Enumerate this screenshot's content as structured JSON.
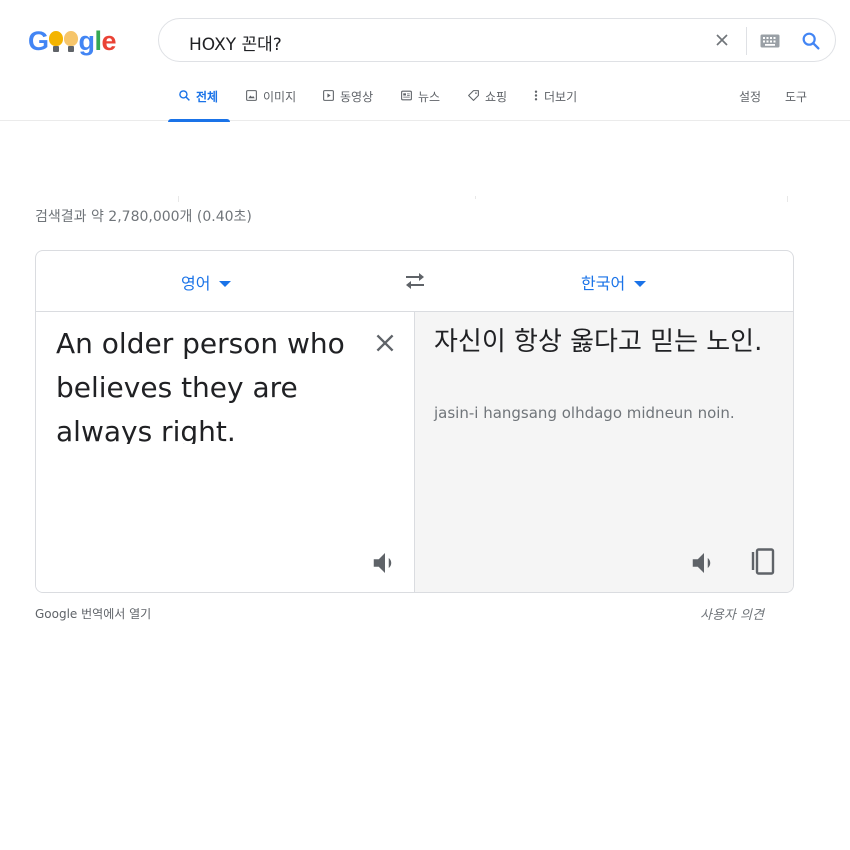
{
  "logo": {
    "g": "G",
    "g2": "g",
    "l": "l",
    "e": "e"
  },
  "search": {
    "query": "HOXY 꼰대?"
  },
  "tabs": [
    {
      "label": "전체",
      "icon": "search-icon",
      "active": true
    },
    {
      "label": "이미지",
      "icon": "image-icon",
      "active": false
    },
    {
      "label": "동영상",
      "icon": "video-icon",
      "active": false
    },
    {
      "label": "뉴스",
      "icon": "news-icon",
      "active": false
    },
    {
      "label": "쇼핑",
      "icon": "tag-icon",
      "active": false
    },
    {
      "label": "더보기",
      "icon": "more-vert-icon",
      "active": false
    }
  ],
  "tools": {
    "settings": "설정",
    "tools": "도구"
  },
  "results": {
    "stats": "검색결과 약 2,780,000개 (0.40초)"
  },
  "translate": {
    "source_lang": "영어",
    "target_lang": "한국어",
    "source_text": "An older person who believes they are always right.",
    "translated_text": "자신이 항상 옳다고 믿는 노인.",
    "romanization": "jasin-i hangsang olhdago midneun noin."
  },
  "footer": {
    "open_in_translate": "Google 번역에서 열기",
    "feedback": "사용자 의견"
  },
  "colors": {
    "accent": "#1a73e8",
    "text": "#202124",
    "muted": "#70757a",
    "border": "#dadce0",
    "target_bg": "#f5f5f5"
  }
}
